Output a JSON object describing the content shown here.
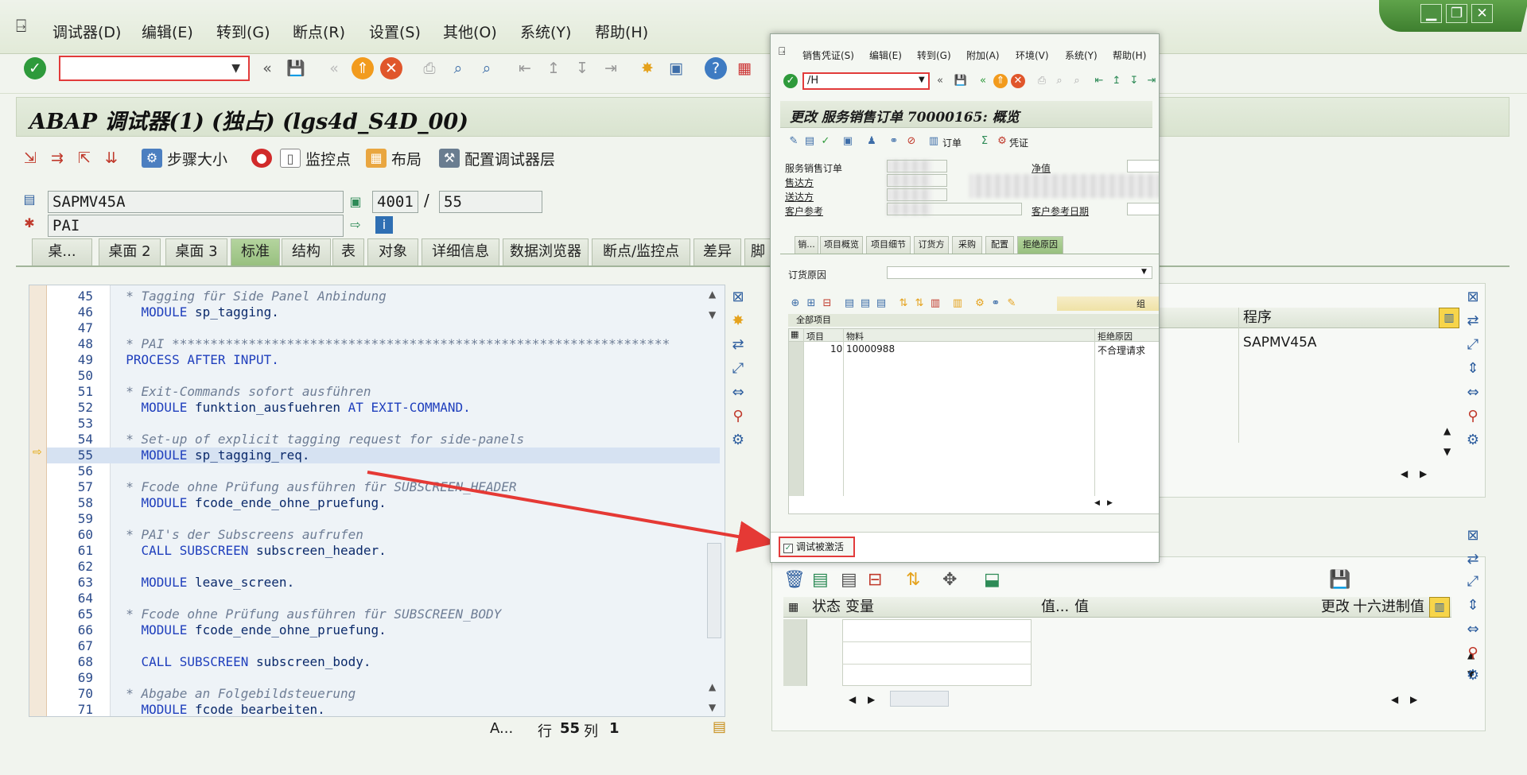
{
  "menu": {
    "items": [
      "调试器(D)",
      "编辑(E)",
      "转到(G)",
      "断点(R)",
      "设置(S)",
      "其他(O)",
      "系统(Y)",
      "帮助(H)"
    ]
  },
  "window_buttons": [
    "▁",
    "❐",
    "✕"
  ],
  "toolbar": {
    "command_value": "",
    "icons": [
      "check-icon",
      "save-icon",
      "back-icon",
      "exit-icon",
      "cancel-icon",
      "print-icon",
      "find-icon",
      "find-next-icon",
      "first-page-icon",
      "prev-page-icon",
      "next-page-icon",
      "last-page-icon",
      "new-session-icon",
      "shortcut-icon",
      "help-icon",
      "layout-icon"
    ]
  },
  "title": "ABAP 调试器(1) (独占)  (lgs4d_S4D_00)",
  "appbar": {
    "step_size": "步骤大小",
    "watchpoint": "监控点",
    "layout": "布局",
    "config_layers": "配置调试器层"
  },
  "fields": {
    "program": "SAPMV45A",
    "screen": "4001",
    "separator": "/",
    "line_count": "55",
    "event": "PAI"
  },
  "tabs": [
    "桌...",
    "桌面 2",
    "桌面 3",
    "标准",
    "结构",
    "表",
    "对象",
    "详细信息",
    "数据浏览器",
    "断点/监控点",
    "差异",
    "脚"
  ],
  "code_lines": [
    {
      "num": "45",
      "kind": "cm",
      "text": "  * Tagging für Side Panel Anbindung"
    },
    {
      "num": "46",
      "kind": "mod",
      "kw": "    MODULE ",
      "rest": "sp_tagging."
    },
    {
      "num": "47",
      "kind": "blank",
      "text": ""
    },
    {
      "num": "48",
      "kind": "cm",
      "text": "  * PAI *****************************************************************"
    },
    {
      "num": "49",
      "kind": "kw",
      "text": "  PROCESS AFTER INPUT."
    },
    {
      "num": "50",
      "kind": "blank",
      "text": ""
    },
    {
      "num": "51",
      "kind": "cm",
      "text": "  * Exit-Commands sofort ausführen"
    },
    {
      "num": "52",
      "kind": "mod",
      "kw": "    MODULE ",
      "rest": "funktion_ausfuehren",
      "kw2": " AT EXIT-COMMAND."
    },
    {
      "num": "53",
      "kind": "blank",
      "text": ""
    },
    {
      "num": "54",
      "kind": "cm",
      "text": "  * Set-up of explicit tagging request for side-panels"
    },
    {
      "num": "55",
      "kind": "mod",
      "kw": "    MODULE ",
      "rest": "sp_tagging_req."
    },
    {
      "num": "56",
      "kind": "blank",
      "text": ""
    },
    {
      "num": "57",
      "kind": "cm",
      "text": "  * Fcode ohne Prüfung ausführen für SUBSCREEN_HEADER"
    },
    {
      "num": "58",
      "kind": "mod",
      "kw": "    MODULE ",
      "rest": "fcode_ende_ohne_pruefung."
    },
    {
      "num": "59",
      "kind": "blank",
      "text": ""
    },
    {
      "num": "60",
      "kind": "cm",
      "text": "  * PAI's der Subscreens aufrufen"
    },
    {
      "num": "61",
      "kind": "mod",
      "kw": "    CALL SUBSCREEN ",
      "rest": "subscreen_header."
    },
    {
      "num": "62",
      "kind": "blank",
      "text": ""
    },
    {
      "num": "63",
      "kind": "mod",
      "kw": "    MODULE ",
      "rest": "leave_screen."
    },
    {
      "num": "64",
      "kind": "blank",
      "text": ""
    },
    {
      "num": "65",
      "kind": "cm",
      "text": "  * Fcode ohne Prüfung ausführen für SUBSCREEN_BODY"
    },
    {
      "num": "66",
      "kind": "mod",
      "kw": "    MODULE ",
      "rest": "fcode_ende_ohne_pruefung."
    },
    {
      "num": "67",
      "kind": "blank",
      "text": ""
    },
    {
      "num": "68",
      "kind": "mod",
      "kw": "    CALL SUBSCREEN ",
      "rest": "subscreen_body."
    },
    {
      "num": "69",
      "kind": "blank",
      "text": ""
    },
    {
      "num": "70",
      "kind": "cm",
      "text": "  * Abgabe an Folgebildsteuerung"
    },
    {
      "num": "71",
      "kind": "mod",
      "kw": "    MODULE ",
      "rest": "fcode_bearbeiten."
    }
  ],
  "current_line": "55",
  "statusbar": {
    "mode": "A...",
    "row_label": "行",
    "row": "55",
    "col_label": "列",
    "col": "1"
  },
  "right_panel": {
    "program_header": "程序",
    "program_value": "SAPMV45A"
  },
  "variables_panel": {
    "headers": [
      "状态",
      "变量",
      "值...",
      "值",
      "更改",
      "十六进制值"
    ]
  },
  "dialog": {
    "menu": [
      "销售凭证(S)",
      "编辑(E)",
      "转到(G)",
      "附加(A)",
      "环境(V)",
      "系统(Y)",
      "帮助(H)"
    ],
    "command": "/H",
    "title": "更改 服务销售订单 70000165: 概览",
    "action_labels": {
      "order": "订单",
      "voucher": "凭证"
    },
    "labels": {
      "service_order": "服务销售订单",
      "net_value": "净值",
      "sold_to": "售达方",
      "ship_to": "送达方",
      "customer_ref": "客户参考",
      "customer_ref_date": "客户参考日期"
    },
    "tabs": [
      "销...",
      "项目概览",
      "项目细节",
      "订货方",
      "采购",
      "配置",
      "拒绝原因"
    ],
    "reason_label": "订货原因",
    "group_label": "组",
    "all_items": "全部项目",
    "grid_headers": [
      "项目",
      "物料",
      "拒绝原因"
    ],
    "row": {
      "item": "10",
      "material": "10000988",
      "reason": "不合理请求"
    },
    "debug_checkbox": "调试被激活"
  },
  "colors": {
    "accent_green": "#98c07f",
    "highlight_red": "#e23b3b",
    "arrow_red": "#e53935"
  }
}
